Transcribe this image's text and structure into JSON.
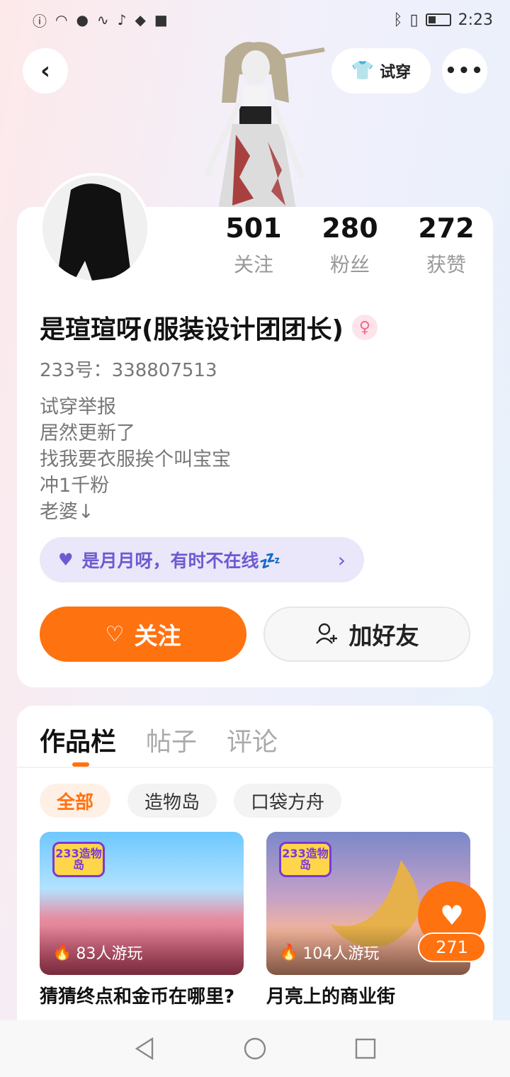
{
  "status_bar": {
    "time": "2:23"
  },
  "header": {
    "tryon_label": "试穿"
  },
  "profile": {
    "stats": [
      {
        "value": "501",
        "label": "关注"
      },
      {
        "value": "280",
        "label": "粉丝"
      },
      {
        "value": "272",
        "label": "获赞"
      }
    ],
    "nickname": "是瑄瑄呀(服装设计团团长)",
    "user_id": "233号：338807513",
    "bio": [
      "试穿举报",
      "居然更新了",
      "找我要衣服挨个叫宝宝",
      "冲1千粉",
      "老婆↓"
    ],
    "relation": "是月月呀，有时不在线💤",
    "follow_label": "关注",
    "add_friend_label": "加好友"
  },
  "works": {
    "tabs": [
      "作品栏",
      "帖子",
      "评论"
    ],
    "chips": [
      "全部",
      "造物岛",
      "口袋方舟"
    ],
    "games": [
      {
        "title": "猜猜终点和金币在哪里?",
        "plays": "83人游玩",
        "logo": "233造物岛"
      },
      {
        "title": "月亮上的商业街",
        "plays": "104人游玩",
        "logo": "233造物岛"
      }
    ],
    "like_count": "271"
  },
  "colors": {
    "accent": "#ff7210",
    "purple": "#6c5bd0"
  }
}
